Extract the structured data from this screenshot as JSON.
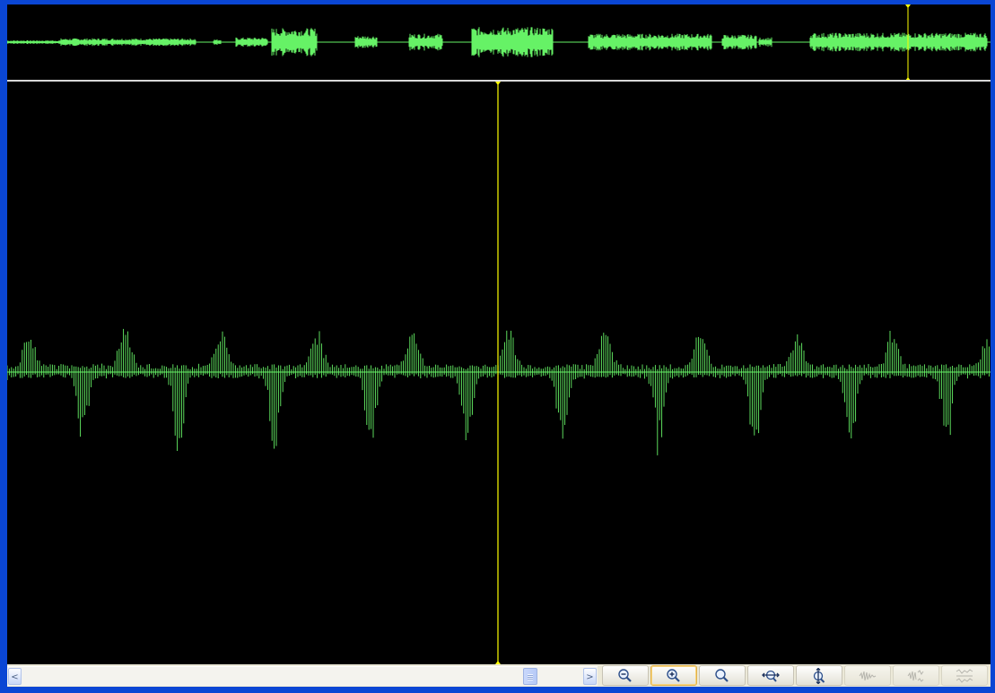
{
  "window": {
    "background_color": "#0a46d4",
    "waveform_color": "#66f266",
    "cursor_color": "#ffff00",
    "view_background": "#000000"
  },
  "overview": {
    "playhead_fraction": 0.916
  },
  "main_view": {
    "playhead_fraction": 0.5
  },
  "scrollbar": {
    "left_arrow": "<",
    "right_arrow": ">",
    "thumb_position_fraction": 0.88
  },
  "toolbar": {
    "buttons": [
      {
        "name": "zoom-out",
        "icon": "zoom-out-icon",
        "active": false,
        "enabled": true
      },
      {
        "name": "zoom-in",
        "icon": "zoom-in-icon",
        "active": true,
        "enabled": true
      },
      {
        "name": "zoom-normal",
        "icon": "zoom-icon",
        "active": false,
        "enabled": true
      },
      {
        "name": "fit-horizontal",
        "icon": "fit-horizontal-icon",
        "active": false,
        "enabled": true
      },
      {
        "name": "fit-vertical",
        "icon": "fit-vertical-icon",
        "active": false,
        "enabled": true
      },
      {
        "name": "wave-mode-1",
        "icon": "waveform-icon",
        "active": false,
        "enabled": false
      },
      {
        "name": "wave-mode-2",
        "icon": "waveform-split-icon",
        "active": false,
        "enabled": false
      },
      {
        "name": "wave-mode-3",
        "icon": "waveform-stack-icon",
        "active": false,
        "enabled": false
      }
    ]
  }
}
